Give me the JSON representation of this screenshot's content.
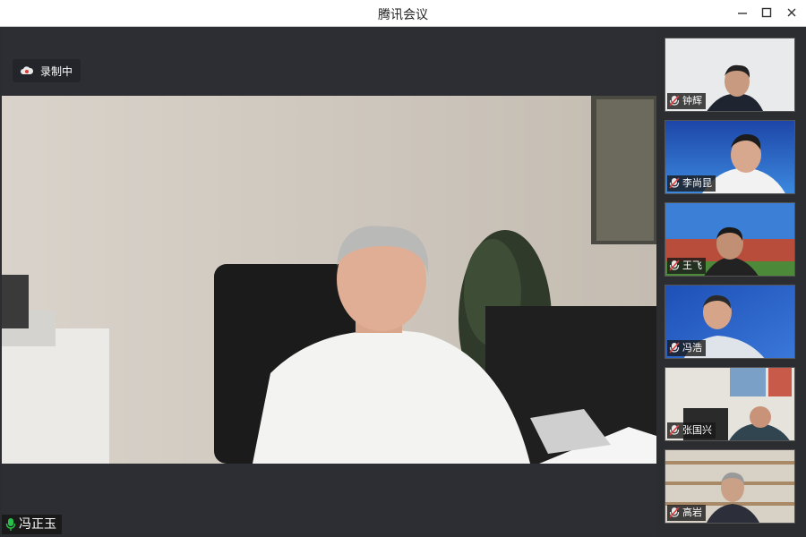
{
  "window": {
    "title": "腾讯会议"
  },
  "recording": {
    "label": "录制中"
  },
  "speaker": {
    "name": "冯正玉"
  },
  "participants": [
    {
      "name": "钟辉"
    },
    {
      "name": "李尚昆"
    },
    {
      "name": "王飞"
    },
    {
      "name": "冯浩"
    },
    {
      "name": "张国兴"
    },
    {
      "name": "高岩"
    }
  ],
  "colors": {
    "accent_mic": "#27c04a",
    "muted_mic": "#e03b3b"
  }
}
